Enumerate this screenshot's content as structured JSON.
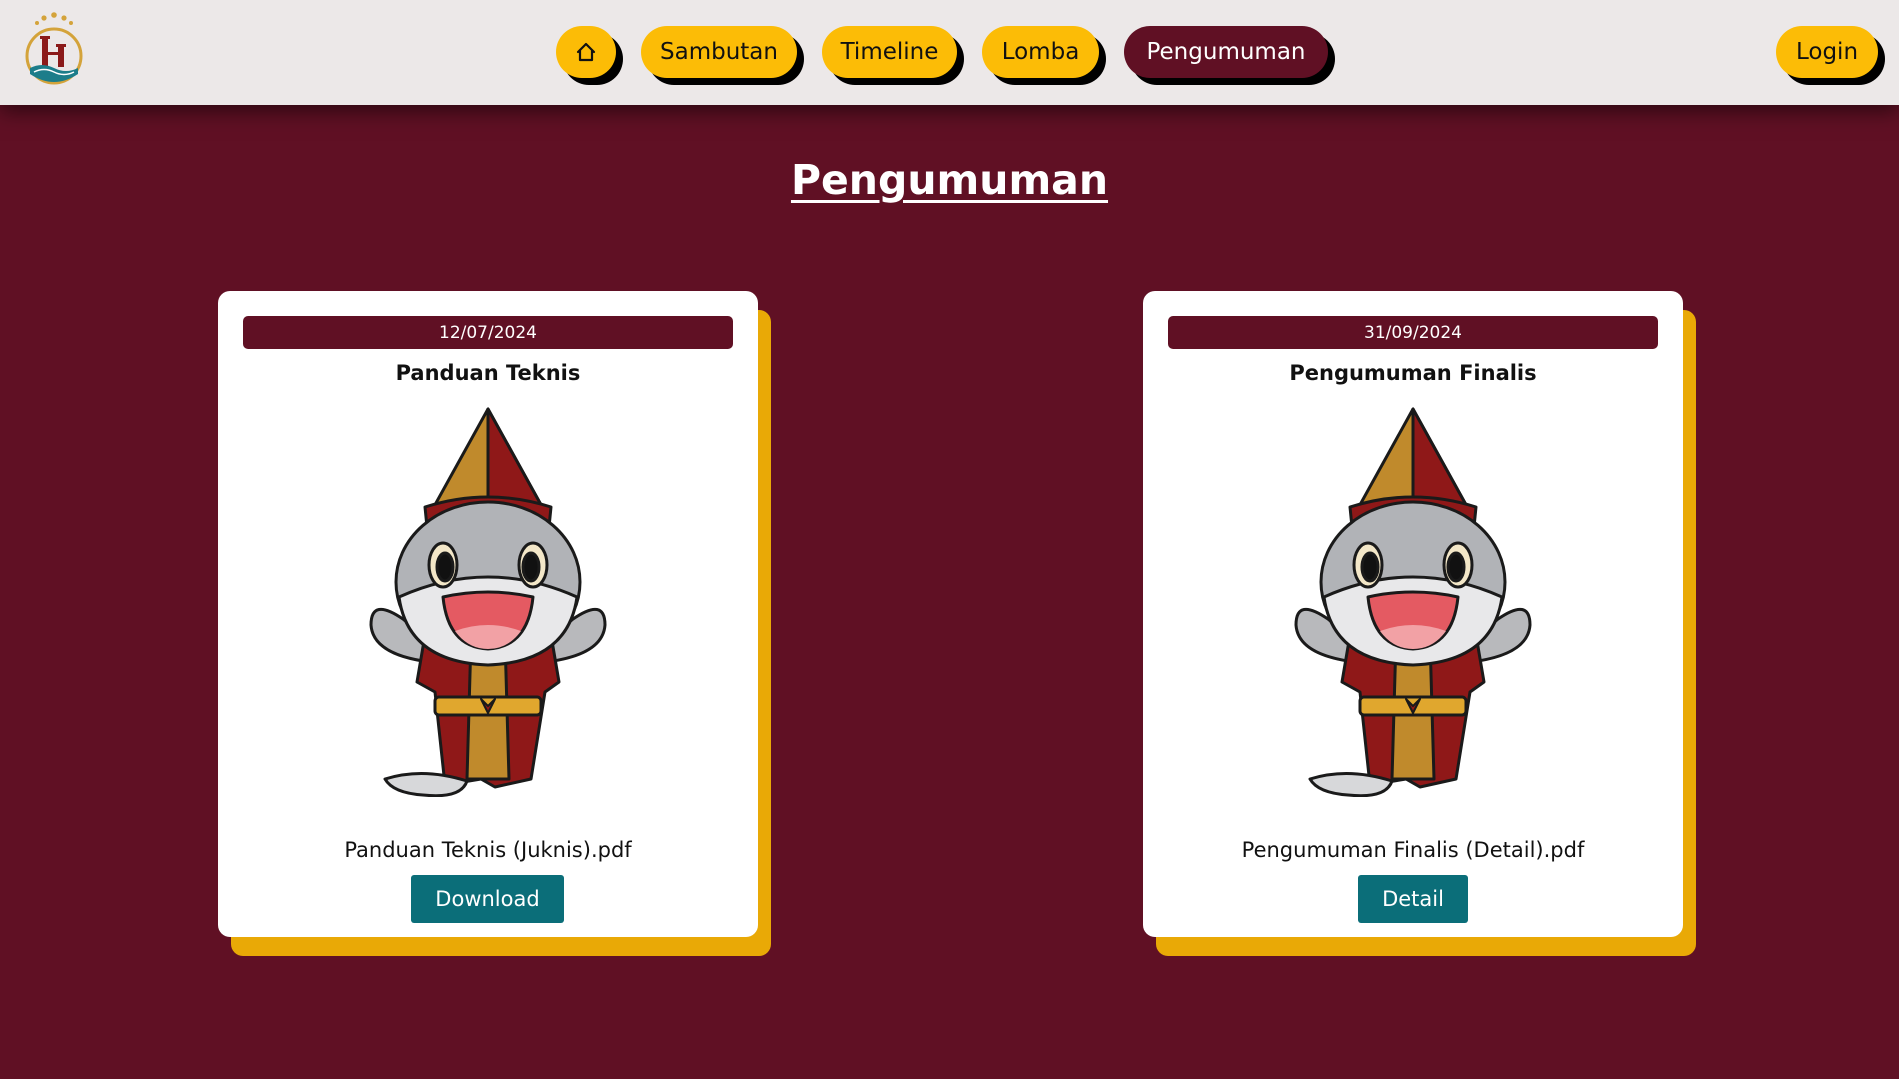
{
  "nav": {
    "logo_icon": "logo-gate-emblem",
    "home_icon": "home-icon",
    "items": [
      {
        "label": "Sambutan"
      },
      {
        "label": "Timeline"
      },
      {
        "label": "Lomba"
      },
      {
        "label": "Pengumuman",
        "active": true
      }
    ],
    "login_label": "Login"
  },
  "page": {
    "title": "Pengumuman"
  },
  "cards": [
    {
      "date": "12/07/2024",
      "title": "Panduan Teknis",
      "image_icon": "mascot-illustration",
      "file_name": "Panduan Teknis (Juknis).pdf",
      "button_label": "Download"
    },
    {
      "date": "31/09/2024",
      "title": "Pengumuman Finalis",
      "image_icon": "mascot-illustration",
      "file_name": "Pengumuman Finalis (Detail).pdf",
      "button_label": "Detail"
    }
  ],
  "colors": {
    "background": "#601024",
    "navbar": "#ece8e8",
    "accent_yellow": "#fcbc06",
    "card_shadow": "#e9a906",
    "button_teal": "#0b6e79"
  }
}
